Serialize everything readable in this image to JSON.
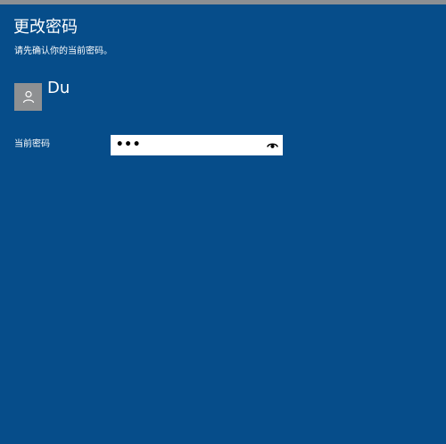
{
  "window": {
    "title": "更改密码",
    "subtitle": "请先确认你的当前密码。"
  },
  "user": {
    "name": "Du",
    "avatar_icon": "person-icon",
    "avatar_color": "#8e9092"
  },
  "password_form": {
    "label": "当前密码",
    "value": "•••",
    "reveal_icon": "eye-icon"
  },
  "colors": {
    "background": "#064d8a",
    "top_strip": "#8b8f93",
    "field_background": "#ffffff"
  }
}
